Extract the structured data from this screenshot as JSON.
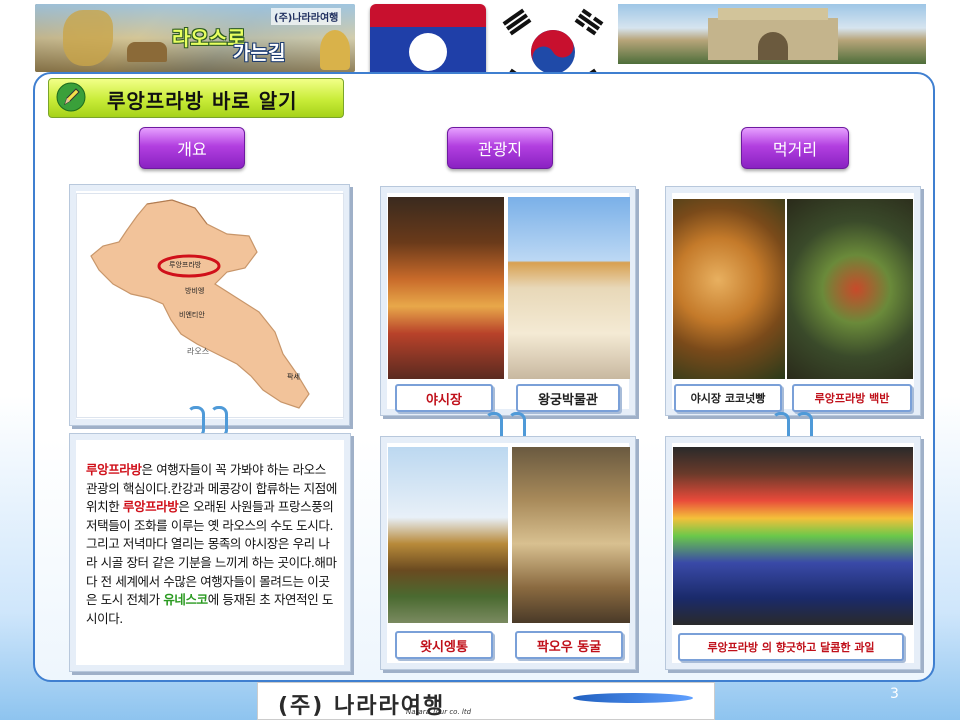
{
  "header": {
    "banner_logo": "(주)나라라여행",
    "banner_title_1": "라오스로",
    "banner_title_2": "가는길"
  },
  "section_title": "루앙프라방 바로 알기",
  "tabs": [
    {
      "label": "개요"
    },
    {
      "label": "관광지"
    },
    {
      "label": "먹거리"
    }
  ],
  "map": {
    "label_city": "루앙프라방",
    "label_vangvieng": "방비엥",
    "label_vientiane": "비엔티안",
    "label_country": "라오스",
    "label_pakse": "팍세"
  },
  "description": {
    "p1_hl": "루앙프라방",
    "p1": "은 여행자들이 꼭 가봐야 하는 라오스 관광의 핵심이다.칸강과 메콩강이 합류하는 지점에 위치한 ",
    "p2_hl": "루앙프라방",
    "p2": "은 오래된 사원들과 프랑스풍의 저택들이 조화를 이루는 옛 라오스의 수도 도시다.그리고 저녁마다 열리는 몽족의 야시장은 우리 나라 시골 장터 같은 기분을 느끼게 하는 곳이다.해마다 전 세계에서 수많은 여행자들이 몰려드는 이곳은 도시 전체가 ",
    "p3_hl": "유네스코",
    "p3": "에 등재된 초 자연적인 도시이다."
  },
  "attractions": {
    "top_left": "야시장",
    "top_right": "왕궁박물관",
    "bottom_left": "왓시엥통",
    "bottom_right": "팍오우 동굴"
  },
  "food": {
    "top_left": "야시장 코코넛빵",
    "top_right": "루앙프라방 백반",
    "bottom": "루앙프라방 의 향긋하고 달콤한 과일"
  },
  "footer": {
    "logo_text": "(주) 나라라여행",
    "logo_sub": "Narara Tour co. ltd",
    "page_number": "3"
  },
  "colors": {
    "accent": "#3f7fd0",
    "tab_purple": "#b23fe0",
    "title_green": "#c8ec38",
    "highlight_red": "#d0101a",
    "highlight_green": "#2a9a20"
  }
}
